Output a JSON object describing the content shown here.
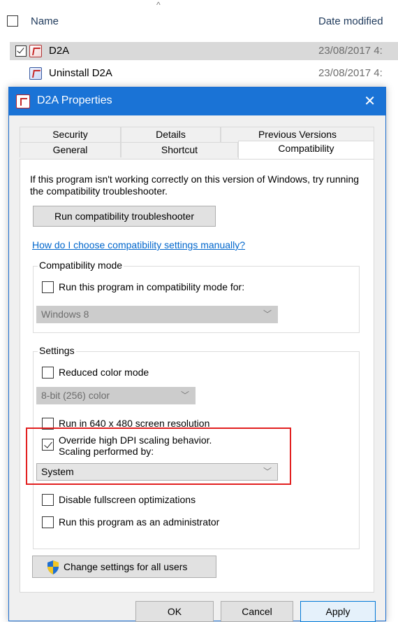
{
  "explorer": {
    "header_name": "Name",
    "header_date": "Date modified",
    "rows": [
      {
        "name": "D2A",
        "date": "23/08/2017 4:",
        "selected": true
      },
      {
        "name": "Uninstall D2A",
        "date": "23/08/2017 4:",
        "selected": false
      }
    ]
  },
  "dialog": {
    "title": "D2A Properties",
    "close": "✕",
    "tabs_row1": [
      "Security",
      "Details",
      "Previous Versions"
    ],
    "tabs_row2": [
      "General",
      "Shortcut",
      "Compatibility"
    ],
    "active_tab": "Compatibility",
    "intro": "If this program isn't working correctly on this version of Windows, try running the compatibility troubleshooter.",
    "run_troubleshooter": "Run compatibility troubleshooter",
    "manual_link": "How do I choose compatibility settings manually?",
    "compat_mode": {
      "title": "Compatibility mode",
      "checkbox_label": "Run this program in compatibility mode for:",
      "checked": false,
      "os_value": "Windows 8"
    },
    "settings": {
      "title": "Settings",
      "reduced_color_label": "Reduced color mode",
      "reduced_color_checked": false,
      "color_value": "8-bit (256) color",
      "res640_label": "Run in 640 x 480 screen resolution",
      "res640_checked": false,
      "dpi_label_line1": "Override high DPI scaling behavior.",
      "dpi_label_line2": "Scaling performed by:",
      "dpi_checked": true,
      "dpi_value": "System",
      "fullscreen_label": "Disable fullscreen optimizations",
      "fullscreen_checked": false,
      "admin_label": "Run this program as an administrator",
      "admin_checked": false
    },
    "change_all_users": "Change settings for all users",
    "buttons": {
      "ok": "OK",
      "cancel": "Cancel",
      "apply": "Apply"
    }
  },
  "colors": {
    "titlebar": "#1a73d6",
    "link": "#0066cc",
    "highlight": "#e22020",
    "selection": "#d9d9d9"
  }
}
